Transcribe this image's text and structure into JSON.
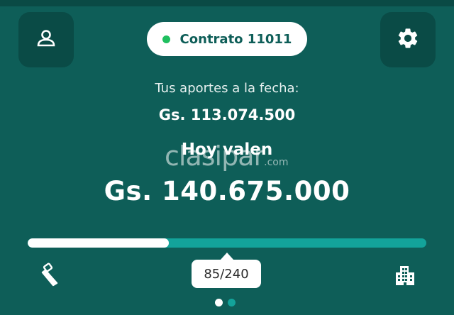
{
  "header": {
    "contract_label": "Contrato 11011",
    "status_color": "#1fbf5f",
    "user_icon": "user-icon",
    "settings_icon": "gear-icon"
  },
  "summary": {
    "aportes_label": "Tus aportes a la fecha:",
    "aportes_value": "Gs. 113.074.500",
    "hoy_label": "Hoy valen",
    "hoy_value": "Gs. 140.675.000"
  },
  "watermark": {
    "text": "clasipar",
    "suffix": ".com"
  },
  "progress": {
    "current": 85,
    "total": 240,
    "label": "85/240",
    "start_icon": "saw-icon",
    "end_icon": "building-icon"
  },
  "pager": {
    "pages": 2,
    "active_index": 0
  },
  "colors": {
    "background": "#0e5e58",
    "accent": "#13a39a",
    "button_bg": "#0a4b46"
  }
}
